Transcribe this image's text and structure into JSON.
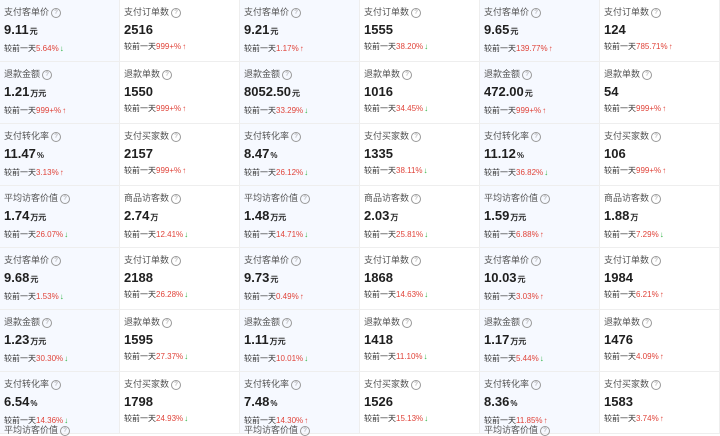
{
  "help_glyph": "?",
  "compare_prefix": "较前一天",
  "cells": [
    {
      "label": "支付客单价",
      "value": "9.11",
      "unit": "元",
      "pct": "5.64%",
      "dir": "down"
    },
    {
      "label": "支付订单数",
      "value": "2516",
      "unit": "",
      "pct": "999+%",
      "dir": "up"
    },
    {
      "label": "支付客单价",
      "value": "9.21",
      "unit": "元",
      "pct": "1.17%",
      "dir": "up"
    },
    {
      "label": "支付订单数",
      "value": "1555",
      "unit": "",
      "pct": "38.20%",
      "dir": "down"
    },
    {
      "label": "支付客单价",
      "value": "9.65",
      "unit": "元",
      "pct": "139.77%",
      "dir": "up"
    },
    {
      "label": "支付订单数",
      "value": "124",
      "unit": "",
      "pct": "785.71%",
      "dir": "up"
    },
    {
      "label": "退款金额",
      "value": "1.21",
      "unit": "万元",
      "pct": "999+%",
      "dir": "up"
    },
    {
      "label": "退款单数",
      "value": "1550",
      "unit": "",
      "pct": "999+%",
      "dir": "up"
    },
    {
      "label": "退款金额",
      "value": "8052.50",
      "unit": "元",
      "pct": "33.29%",
      "dir": "down"
    },
    {
      "label": "退款单数",
      "value": "1016",
      "unit": "",
      "pct": "34.45%",
      "dir": "down"
    },
    {
      "label": "退款金额",
      "value": "472.00",
      "unit": "元",
      "pct": "999+%",
      "dir": "up"
    },
    {
      "label": "退款单数",
      "value": "54",
      "unit": "",
      "pct": "999+%",
      "dir": "up"
    },
    {
      "label": "支付转化率",
      "value": "11.47",
      "unit": "%",
      "pct": "3.13%",
      "dir": "up"
    },
    {
      "label": "支付买家数",
      "value": "2157",
      "unit": "",
      "pct": "999+%",
      "dir": "up"
    },
    {
      "label": "支付转化率",
      "value": "8.47",
      "unit": "%",
      "pct": "26.12%",
      "dir": "down"
    },
    {
      "label": "支付买家数",
      "value": "1335",
      "unit": "",
      "pct": "38.11%",
      "dir": "down"
    },
    {
      "label": "支付转化率",
      "value": "11.12",
      "unit": "%",
      "pct": "36.82%",
      "dir": "down"
    },
    {
      "label": "支付买家数",
      "value": "106",
      "unit": "",
      "pct": "999+%",
      "dir": "up"
    },
    {
      "label": "平均访客价值",
      "value": "1.74",
      "unit": "万元",
      "pct": "26.07%",
      "dir": "down"
    },
    {
      "label": "商品访客数",
      "value": "2.74",
      "unit": "万",
      "pct": "12.41%",
      "dir": "down"
    },
    {
      "label": "平均访客价值",
      "value": "1.48",
      "unit": "万元",
      "pct": "14.71%",
      "dir": "down"
    },
    {
      "label": "商品访客数",
      "value": "2.03",
      "unit": "万",
      "pct": "25.81%",
      "dir": "down"
    },
    {
      "label": "平均访客价值",
      "value": "1.59",
      "unit": "万元",
      "pct": "6.88%",
      "dir": "up"
    },
    {
      "label": "商品访客数",
      "value": "1.88",
      "unit": "万",
      "pct": "7.29%",
      "dir": "down"
    },
    {
      "label": "支付客单价",
      "value": "9.68",
      "unit": "元",
      "pct": "1.53%",
      "dir": "down"
    },
    {
      "label": "支付订单数",
      "value": "2188",
      "unit": "",
      "pct": "26.28%",
      "dir": "down"
    },
    {
      "label": "支付客单价",
      "value": "9.73",
      "unit": "元",
      "pct": "0.49%",
      "dir": "up"
    },
    {
      "label": "支付订单数",
      "value": "1868",
      "unit": "",
      "pct": "14.63%",
      "dir": "down"
    },
    {
      "label": "支付客单价",
      "value": "10.03",
      "unit": "元",
      "pct": "3.03%",
      "dir": "up"
    },
    {
      "label": "支付订单数",
      "value": "1984",
      "unit": "",
      "pct": "6.21%",
      "dir": "up"
    },
    {
      "label": "退款金额",
      "value": "1.23",
      "unit": "万元",
      "pct": "30.30%",
      "dir": "down"
    },
    {
      "label": "退款单数",
      "value": "1595",
      "unit": "",
      "pct": "27.37%",
      "dir": "down"
    },
    {
      "label": "退款金额",
      "value": "1.11",
      "unit": "万元",
      "pct": "10.01%",
      "dir": "down"
    },
    {
      "label": "退款单数",
      "value": "1418",
      "unit": "",
      "pct": "11.10%",
      "dir": "down"
    },
    {
      "label": "退款金额",
      "value": "1.17",
      "unit": "万元",
      "pct": "5.44%",
      "dir": "down"
    },
    {
      "label": "退款单数",
      "value": "1476",
      "unit": "",
      "pct": "4.09%",
      "dir": "up"
    },
    {
      "label": "支付转化率",
      "value": "6.54",
      "unit": "%",
      "pct": "14.36%",
      "dir": "down"
    },
    {
      "label": "支付买家数",
      "value": "1798",
      "unit": "",
      "pct": "24.93%",
      "dir": "down"
    },
    {
      "label": "支付转化率",
      "value": "7.48",
      "unit": "%",
      "pct": "14.30%",
      "dir": "up"
    },
    {
      "label": "支付买家数",
      "value": "1526",
      "unit": "",
      "pct": "15.13%",
      "dir": "down"
    },
    {
      "label": "支付转化率",
      "value": "8.36",
      "unit": "%",
      "pct": "11.85%",
      "dir": "up"
    },
    {
      "label": "支付买家数",
      "value": "1583",
      "unit": "",
      "pct": "3.74%",
      "dir": "up"
    }
  ],
  "footer_labels": [
    "平均访客价值",
    "",
    "平均访客价值",
    "",
    "平均访客价值",
    ""
  ],
  "colors": {
    "up": "#e0443a",
    "down": "#2fb344",
    "pct": "#e0443a"
  }
}
